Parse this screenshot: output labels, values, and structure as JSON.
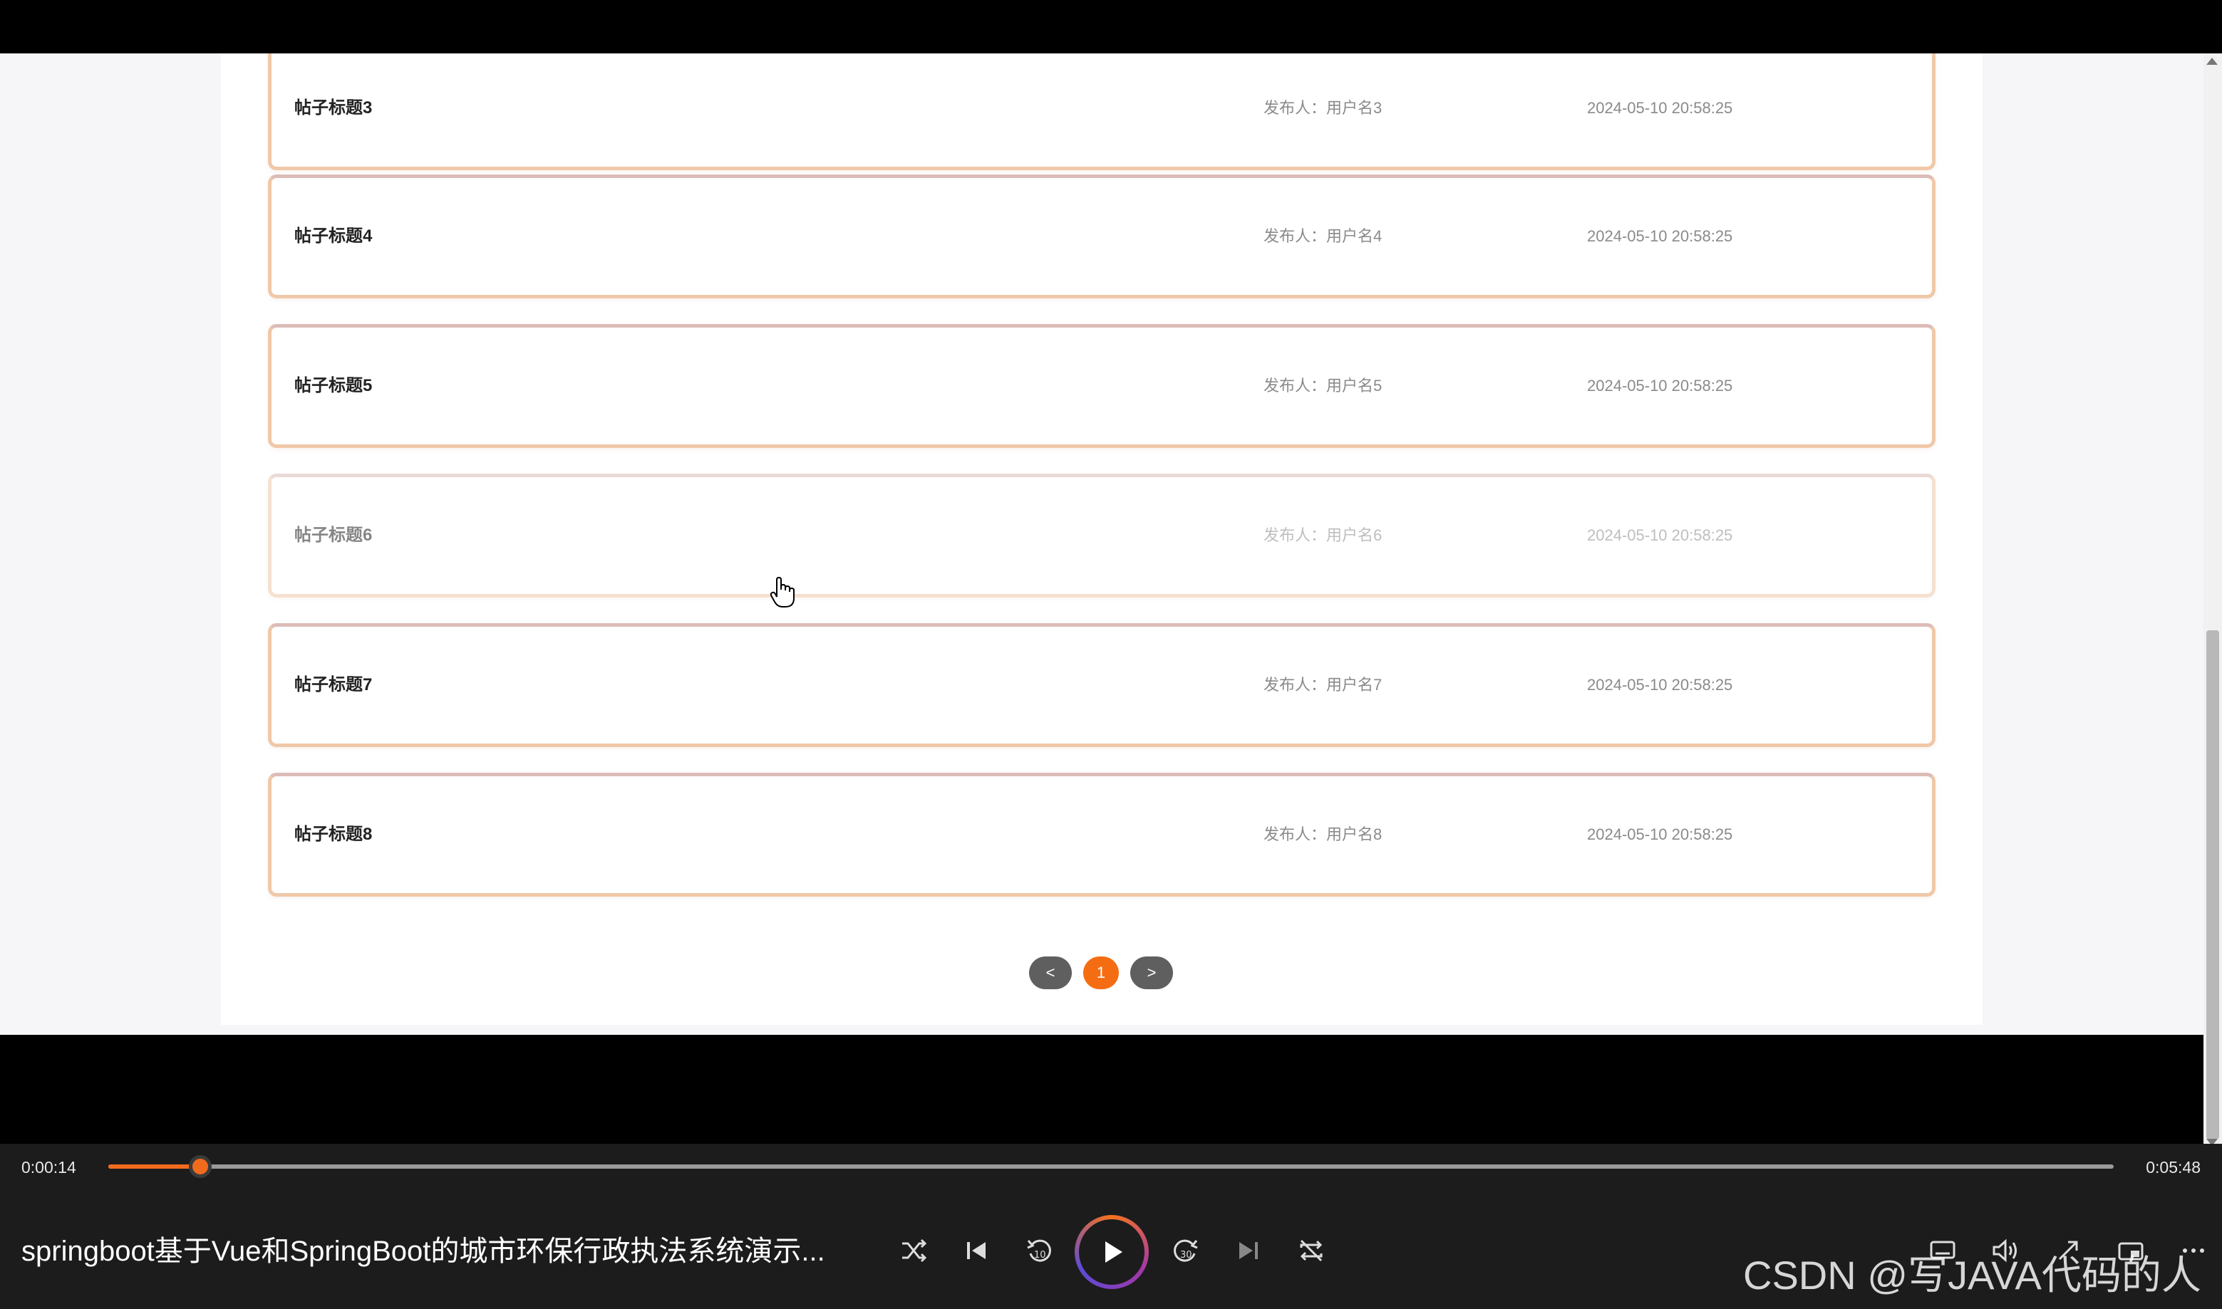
{
  "posts": [
    {
      "title": "帖子标题3",
      "author": "发布人：用户名3",
      "time": "2024-05-10 20:58:25"
    },
    {
      "title": "帖子标题4",
      "author": "发布人：用户名4",
      "time": "2024-05-10 20:58:25"
    },
    {
      "title": "帖子标题5",
      "author": "发布人：用户名5",
      "time": "2024-05-10 20:58:25"
    },
    {
      "title": "帖子标题6",
      "author": "发布人：用户名6",
      "time": "2024-05-10 20:58:25"
    },
    {
      "title": "帖子标题7",
      "author": "发布人：用户名7",
      "time": "2024-05-10 20:58:25"
    },
    {
      "title": "帖子标题8",
      "author": "发布人：用户名8",
      "time": "2024-05-10 20:58:25"
    }
  ],
  "pagination": {
    "prev": "<",
    "current": "1",
    "next": ">"
  },
  "player": {
    "current_time": "0:00:14",
    "total_time": "0:05:48",
    "progress_fraction": 0.046,
    "title": "springboot基于Vue和SpringBoot的城市环保行政执法系统演示...",
    "accent_color": "#f26b1d"
  },
  "watermark": "CSDN @写JAVA代码的人",
  "icons": [
    "shuffle-icon",
    "skip-previous-icon",
    "rewind-10-icon",
    "play-icon",
    "forward-30-icon",
    "skip-next-icon",
    "repeat-off-icon",
    "subtitles-icon",
    "volume-icon",
    "expand-icon",
    "mini-player-icon",
    "more-icon",
    "hand-cursor-icon"
  ]
}
